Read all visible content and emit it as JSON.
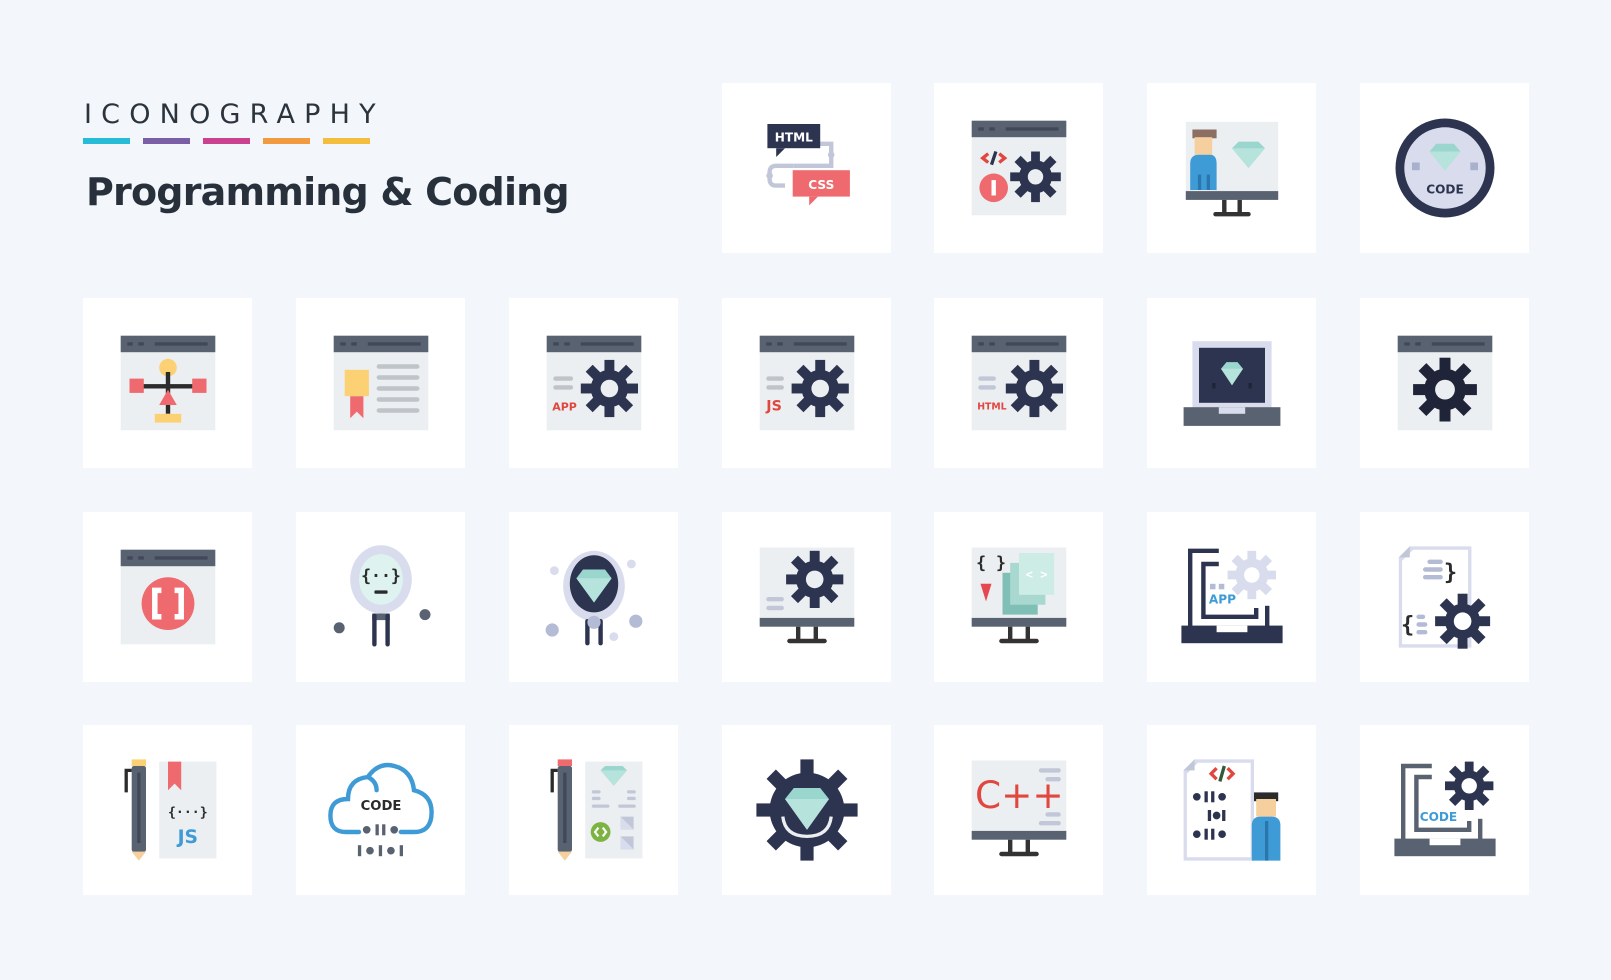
{
  "header": {
    "brand": "ICONOGRAPHY",
    "brand_bar_colors": [
      "#26bcd7",
      "#7a5fa6",
      "#c9418f",
      "#f29a3f",
      "#f3bd3d"
    ],
    "title": "Programming & Coding"
  },
  "colors": {
    "background": "#f3f7fb",
    "card": "#ffffff",
    "dark": "#2d3450",
    "slate": "#596270",
    "panel": "#eceff1",
    "red": "#ef6a6e",
    "yellow": "#fbd174",
    "teal": "#9ad6cd",
    "blue": "#3e9bd6",
    "lavender": "#d8dcec",
    "green": "#7cb342"
  },
  "icons": [
    {
      "name": "html-css-icon",
      "labels": [
        "HTML",
        "CSS"
      ]
    },
    {
      "name": "browser-code-settings-icon",
      "labels": [
        "</>"
      ]
    },
    {
      "name": "developer-monitor-icon",
      "labels": []
    },
    {
      "name": "code-badge-icon",
      "labels": [
        "CODE"
      ]
    },
    {
      "name": "browser-flowchart-icon",
      "labels": []
    },
    {
      "name": "browser-certificate-icon",
      "labels": []
    },
    {
      "name": "browser-app-settings-icon",
      "labels": [
        "APP"
      ]
    },
    {
      "name": "browser-js-settings-icon",
      "labels": [
        "JS"
      ]
    },
    {
      "name": "browser-html-settings-icon",
      "labels": [
        "HTML"
      ]
    },
    {
      "name": "laptop-diamond-icon",
      "labels": []
    },
    {
      "name": "browser-settings-icon",
      "labels": []
    },
    {
      "name": "browser-brackets-icon",
      "labels": [
        "[ ]"
      ]
    },
    {
      "name": "code-bulb-icon",
      "labels": [
        "{··}"
      ]
    },
    {
      "name": "diamond-bulb-icon",
      "labels": []
    },
    {
      "name": "monitor-settings-icon",
      "labels": []
    },
    {
      "name": "monitor-layers-code-icon",
      "labels": [
        "{ }",
        "< >"
      ]
    },
    {
      "name": "laptop-app-settings-icon",
      "labels": [
        "APP"
      ]
    },
    {
      "name": "file-code-settings-icon",
      "labels": [
        "}",
        "{"
      ]
    },
    {
      "name": "pen-js-book-icon",
      "labels": [
        "{···}",
        "JS"
      ]
    },
    {
      "name": "cloud-code-icon",
      "labels": [
        "CODE"
      ]
    },
    {
      "name": "pen-design-sheet-icon",
      "labels": []
    },
    {
      "name": "gear-diamond-icon",
      "labels": []
    },
    {
      "name": "monitor-cpp-icon",
      "labels": [
        "C++"
      ]
    },
    {
      "name": "developer-binary-file-icon",
      "labels": [
        "</>"
      ]
    },
    {
      "name": "laptop-code-settings-icon",
      "labels": [
        "CODE"
      ]
    }
  ]
}
